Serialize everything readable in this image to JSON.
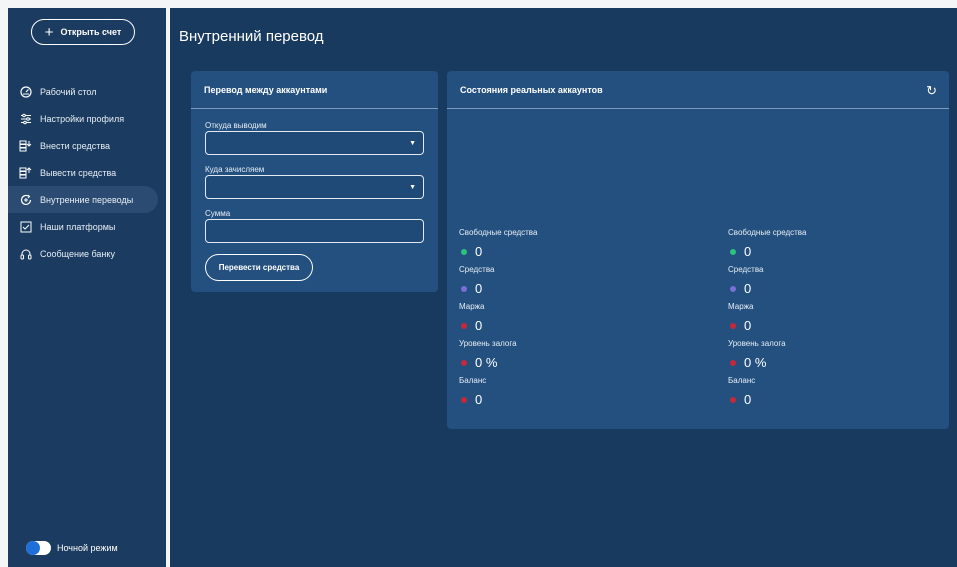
{
  "sidebar": {
    "open_account_label": "Открыть счет",
    "items": [
      {
        "label": "Рабочий стол",
        "icon": "dashboard-icon",
        "active": false
      },
      {
        "label": "Настройки профиля",
        "icon": "sliders-icon",
        "active": false
      },
      {
        "label": "Внести средства",
        "icon": "deposit-icon",
        "active": false
      },
      {
        "label": "Вывести средства",
        "icon": "withdraw-icon",
        "active": false
      },
      {
        "label": "Внутренние переводы",
        "icon": "transfer-icon",
        "active": true
      },
      {
        "label": "Наши платформы",
        "icon": "checkbox-icon",
        "active": false
      },
      {
        "label": "Сообщение банку",
        "icon": "headset-icon",
        "active": false
      }
    ],
    "night_mode_label": "Ночной режим",
    "night_mode_on": true
  },
  "main": {
    "title": "Внутренний перевод"
  },
  "transfer_card": {
    "title": "Перевод между аккаунтами",
    "from_label": "Откуда выводим",
    "from_value": "",
    "to_label": "Куда зачисляем",
    "to_value": "",
    "amount_label": "Сумма",
    "amount_value": "",
    "submit_label": "Перевести средства"
  },
  "accounts_card": {
    "title": "Состояния реальных аккаунтов",
    "columns": [
      {
        "stats": [
          {
            "label": "Свободные средства",
            "value": "0",
            "color": "#2ec27e"
          },
          {
            "label": "Средства",
            "value": "0",
            "color": "#7b6fd6"
          },
          {
            "label": "Маржа",
            "value": "0",
            "color": "#c6283b"
          },
          {
            "label": "Уровень залога",
            "value": "0 %",
            "color": "#c6283b"
          },
          {
            "label": "Баланс",
            "value": "0",
            "color": "#c6283b"
          }
        ]
      },
      {
        "stats": [
          {
            "label": "Свободные средства",
            "value": "0",
            "color": "#2ec27e"
          },
          {
            "label": "Средства",
            "value": "0",
            "color": "#7b6fd6"
          },
          {
            "label": "Маржа",
            "value": "0",
            "color": "#c6283b"
          },
          {
            "label": "Уровень залога",
            "value": "0 %",
            "color": "#c6283b"
          },
          {
            "label": "Баланс",
            "value": "0",
            "color": "#c6283b"
          }
        ]
      }
    ]
  }
}
